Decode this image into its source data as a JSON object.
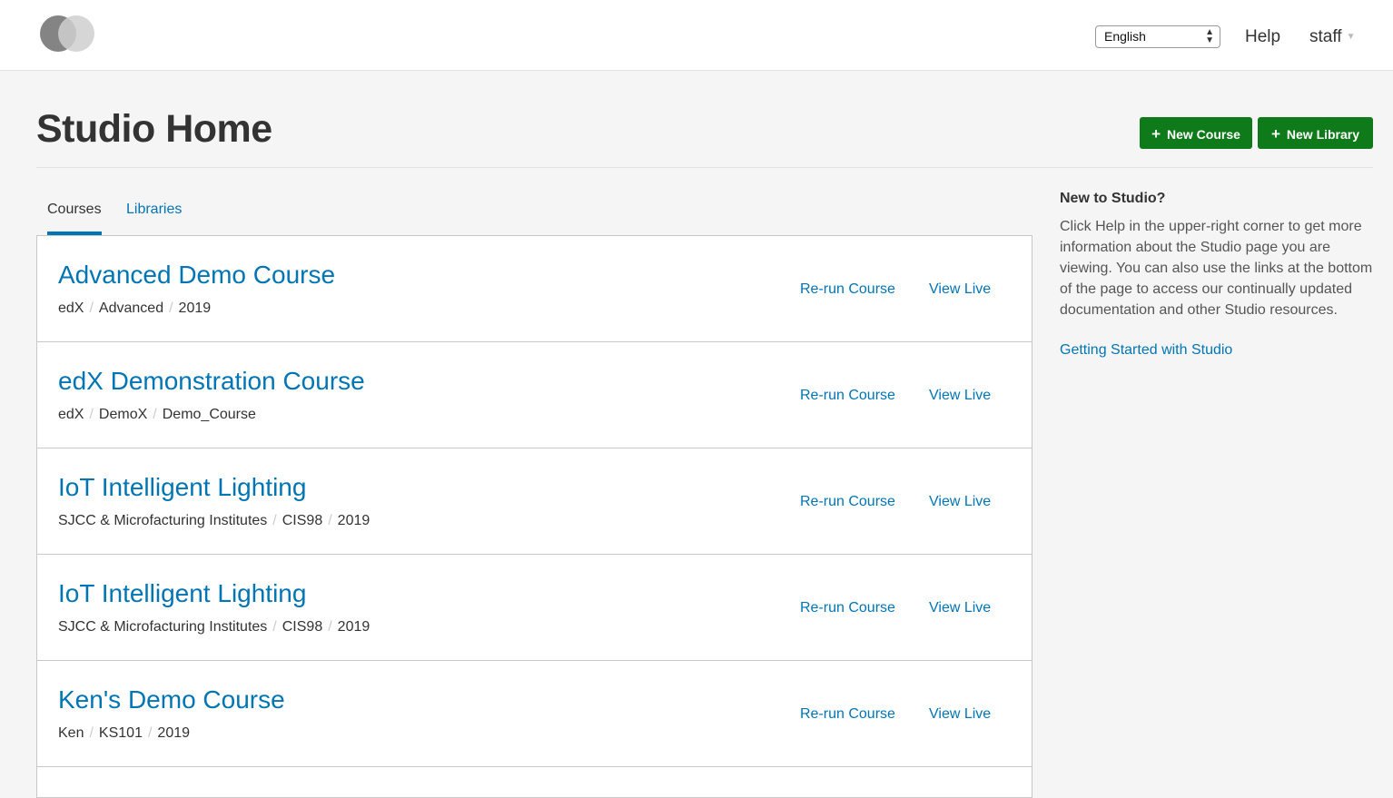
{
  "header": {
    "language_selected": "English",
    "help_label": "Help",
    "user_label": "staff"
  },
  "page": {
    "title": "Studio Home",
    "new_course_label": "New Course",
    "new_library_label": "New Library"
  },
  "tabs": [
    {
      "label": "Courses",
      "active": true
    },
    {
      "label": "Libraries",
      "active": false
    }
  ],
  "courses": [
    {
      "name": "Advanced Demo Course",
      "org": "edX",
      "number": "Advanced",
      "run": "2019",
      "rerun_label": "Re-run Course",
      "view_label": "View Live"
    },
    {
      "name": "edX Demonstration Course",
      "org": "edX",
      "number": "DemoX",
      "run": "Demo_Course",
      "rerun_label": "Re-run Course",
      "view_label": "View Live"
    },
    {
      "name": "IoT Intelligent Lighting",
      "org": "SJCC & Microfacturing Institutes",
      "number": "CIS98",
      "run": "2019",
      "rerun_label": "Re-run Course",
      "view_label": "View Live"
    },
    {
      "name": "IoT Intelligent Lighting",
      "org": "SJCC & Microfacturing Institutes",
      "number": "CIS98",
      "run": "2019",
      "rerun_label": "Re-run Course",
      "view_label": "View Live"
    },
    {
      "name": "Ken's Demo Course",
      "org": "Ken",
      "number": "KS101",
      "run": "2019",
      "rerun_label": "Re-run Course",
      "view_label": "View Live"
    }
  ],
  "sidebar": {
    "title": "New to Studio?",
    "text": "Click Help in the upper-right corner to get more information about the Studio page you are viewing. You can also use the links at the bottom of the page to access our continually updated documentation and other Studio resources.",
    "link_label": "Getting Started with Studio"
  },
  "colors": {
    "link": "#0075b4",
    "primary_button": "#0e7a1a",
    "background": "#f5f5f5"
  }
}
